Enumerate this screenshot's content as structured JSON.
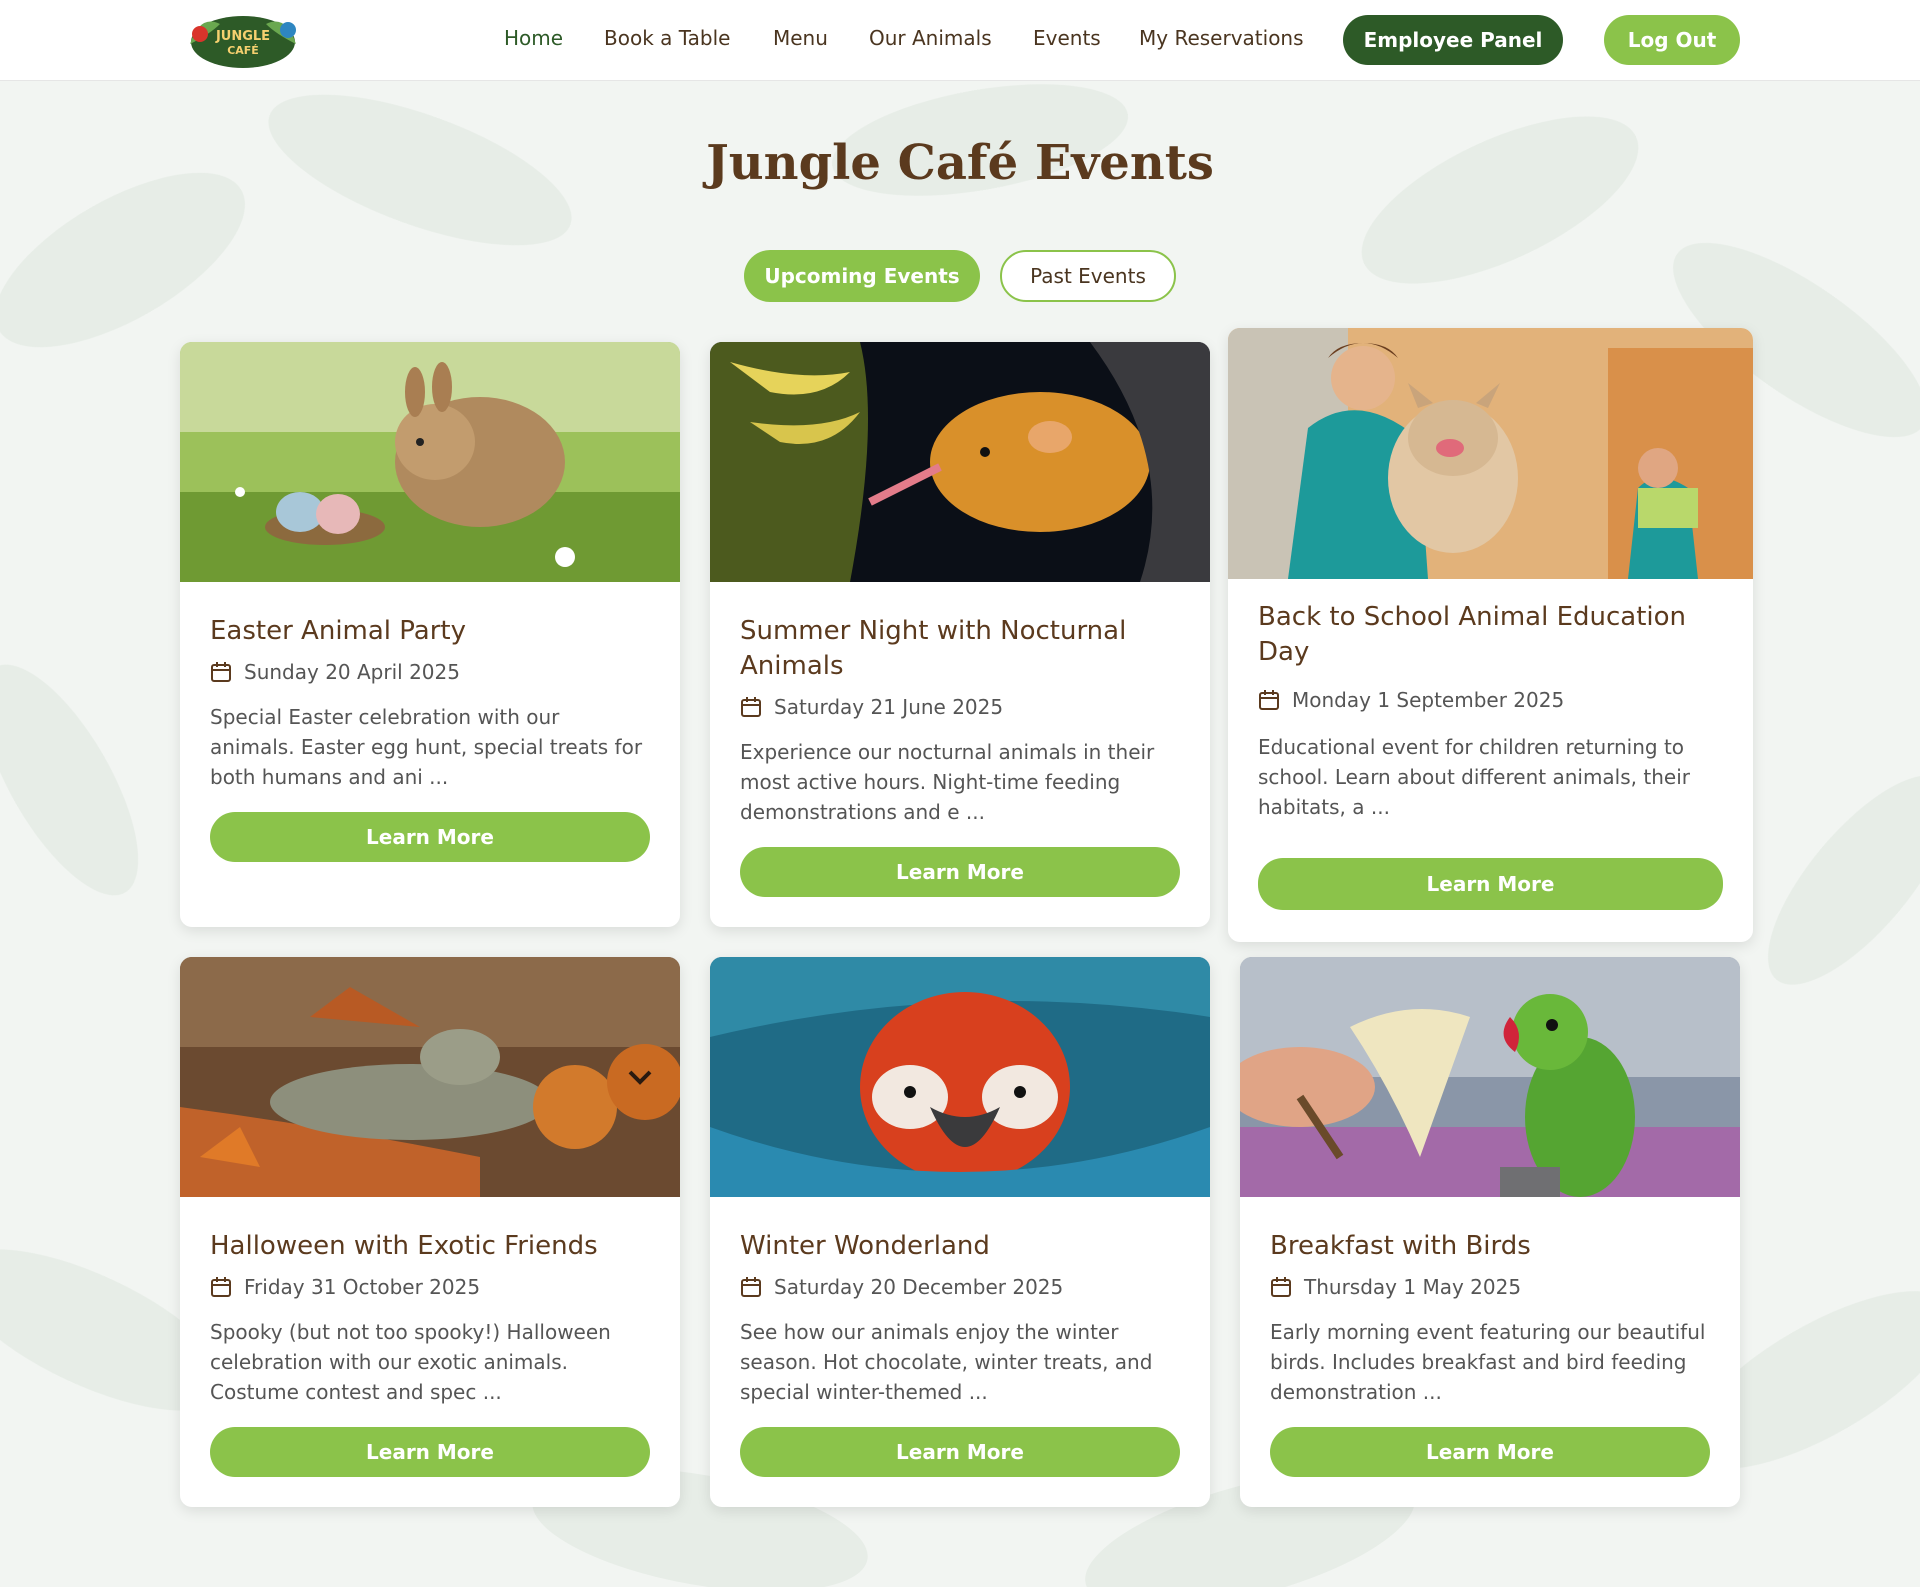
{
  "header": {
    "logo_text": "JUNGLE CAFÉ",
    "nav": [
      {
        "label": "Home",
        "active": true
      },
      {
        "label": "Book a Table"
      },
      {
        "label": "Menu"
      },
      {
        "label": "Our Animals"
      },
      {
        "label": "Events"
      },
      {
        "label": "My Reservations"
      }
    ],
    "employee_panel_label": "Employee Panel",
    "logout_label": "Log Out"
  },
  "page": {
    "title": "Jungle Café Events",
    "tabs": {
      "upcoming": "Upcoming Events",
      "past": "Past Events"
    },
    "active_tab": "upcoming"
  },
  "events": [
    {
      "title": "Easter Animal Party",
      "date": "Sunday 20 April 2025",
      "description": "Special Easter celebration with our animals. Easter egg hunt, special treats for both humans and ani ...",
      "button": "Learn More",
      "image": "rabbit-with-easter-eggs"
    },
    {
      "title": "Summer Night with Nocturnal Animals",
      "date": "Saturday 21 June 2025",
      "description": "Experience our nocturnal animals in their most active hours. Night-time feeding demonstrations and e ...",
      "button": "Learn More",
      "image": "nectar-bat"
    },
    {
      "title": "Back to School Animal Education Day",
      "date": "Monday 1 September 2025",
      "description": "Educational event for children returning to school. Learn about different animals, their habitats, a ...",
      "button": "Learn More",
      "image": "vet-with-french-bulldog"
    },
    {
      "title": "Halloween with Exotic Friends",
      "date": "Friday 31 October 2025",
      "description": "Spooky (but not too spooky!) Halloween celebration with our exotic animals. Costume contest and spec ...",
      "button": "Learn More",
      "image": "iguana-with-pumpkins"
    },
    {
      "title": "Winter Wonderland",
      "date": "Saturday 20 December 2025",
      "description": "See how our animals enjoy the winter season. Hot chocolate, winter treats, and special winter-themed ...",
      "button": "Learn More",
      "image": "macaw-in-blanket"
    },
    {
      "title": "Breakfast with Birds",
      "date": "Thursday 1 May 2025",
      "description": "Early morning event featuring our beautiful birds. Includes breakfast and bird feeding demonstration ...",
      "button": "Learn More",
      "image": "parakeet-eating-banana"
    }
  ],
  "colors": {
    "accent": "#8bc34a",
    "dark_green": "#2d5a27",
    "title_brown": "#5b3a1e"
  }
}
